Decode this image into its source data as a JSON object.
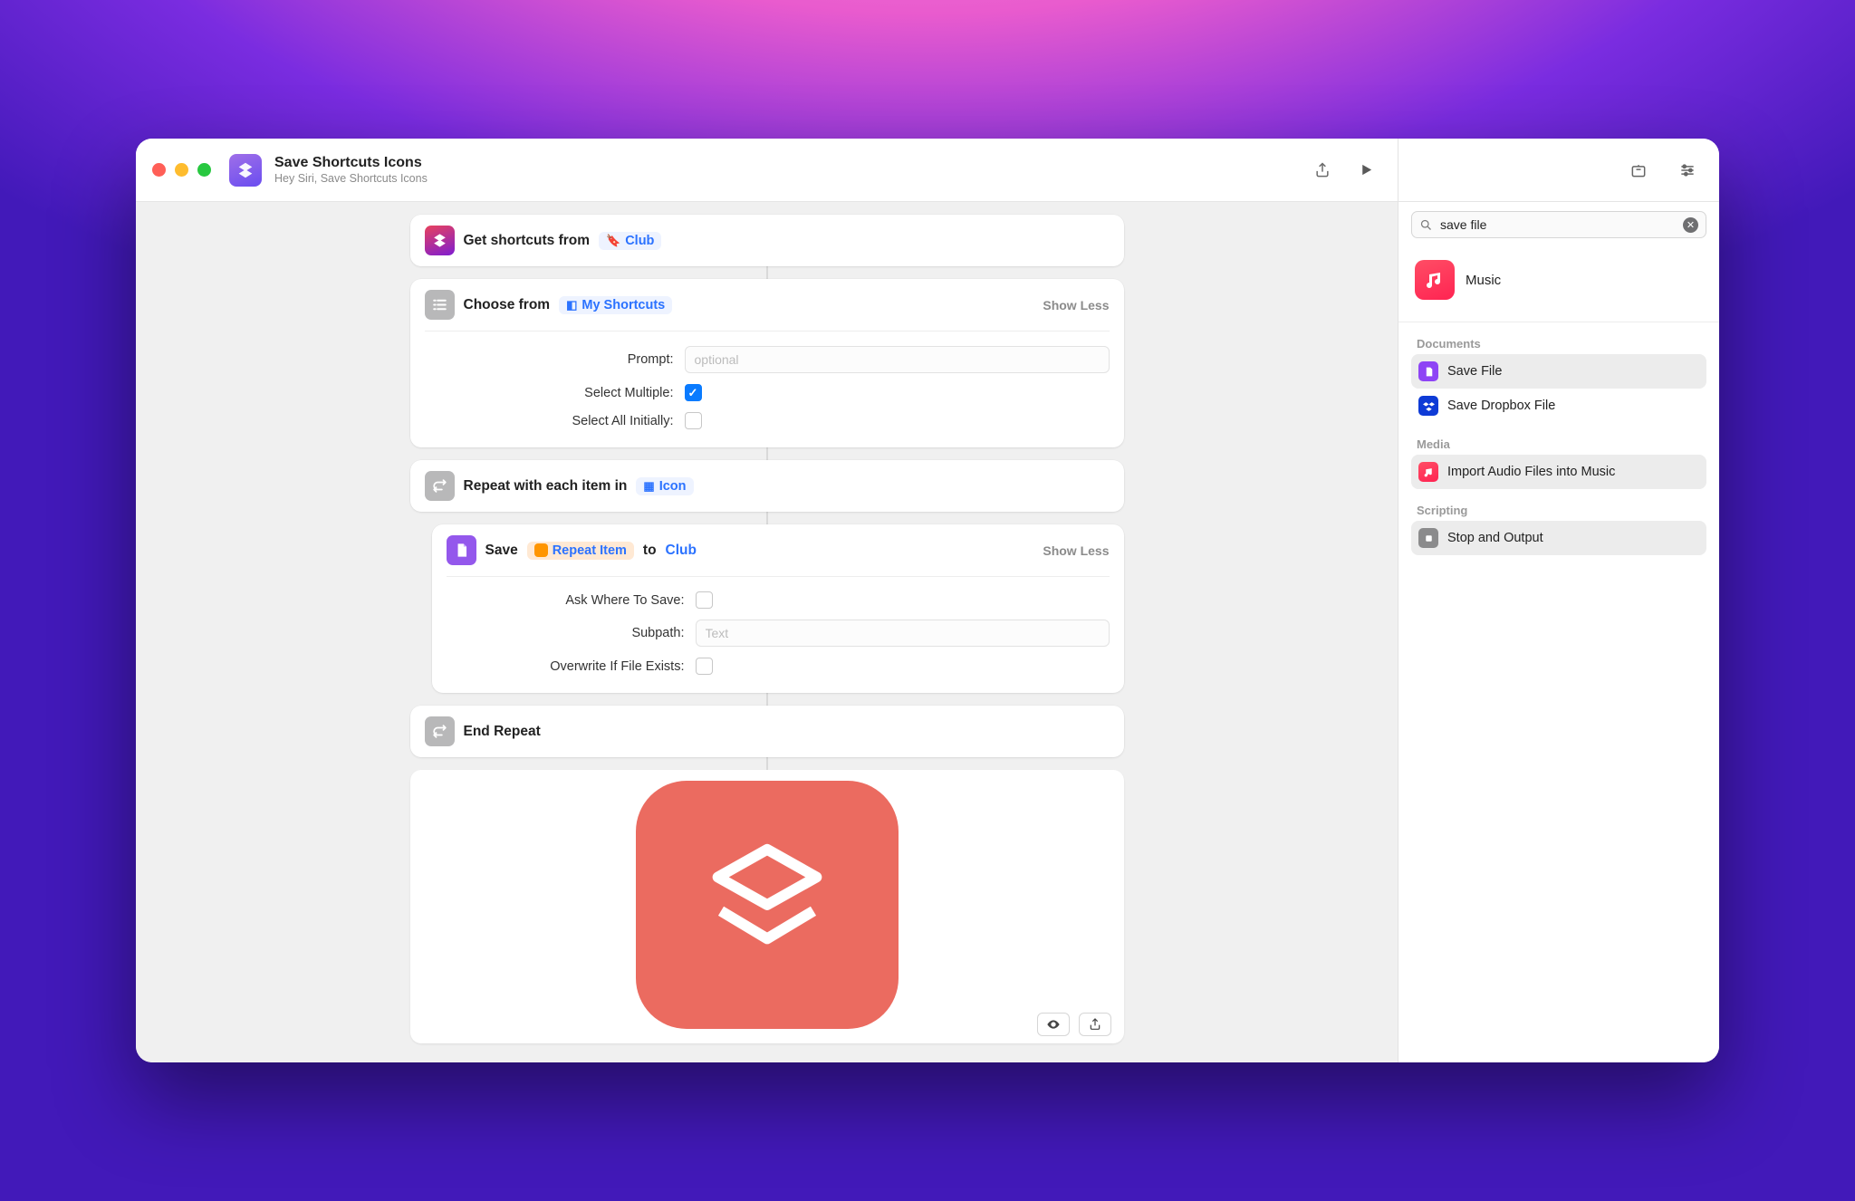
{
  "header": {
    "title": "Save Shortcuts Icons",
    "subtitle": "Hey Siri, Save Shortcuts Icons"
  },
  "actions": {
    "get_shortcuts": {
      "prefix": "Get shortcuts from",
      "folder": "Club"
    },
    "choose": {
      "prefix": "Choose from",
      "source": "My Shortcuts",
      "toggle": "Show Less",
      "prompt_label": "Prompt:",
      "prompt_placeholder": "optional",
      "select_multiple_label": "Select Multiple:",
      "select_all_label": "Select All Initially:"
    },
    "repeat": {
      "prefix": "Repeat with each item in",
      "var": "Icon"
    },
    "save": {
      "verb": "Save",
      "item": "Repeat Item",
      "to": "to",
      "dest": "Club",
      "toggle": "Show Less",
      "ask_label": "Ask Where To Save:",
      "subpath_label": "Subpath:",
      "subpath_placeholder": "Text",
      "overwrite_label": "Overwrite If File Exists:"
    },
    "end_repeat": "End Repeat"
  },
  "sidebar": {
    "search_value": "save file",
    "apps": {
      "music": "Music"
    },
    "sections": {
      "documents": {
        "heading": "Documents",
        "save_file": "Save File",
        "save_dropbox": "Save Dropbox File"
      },
      "media": {
        "heading": "Media",
        "import_audio": "Import Audio Files into Music"
      },
      "scripting": {
        "heading": "Scripting",
        "stop_output": "Stop and Output"
      }
    }
  }
}
